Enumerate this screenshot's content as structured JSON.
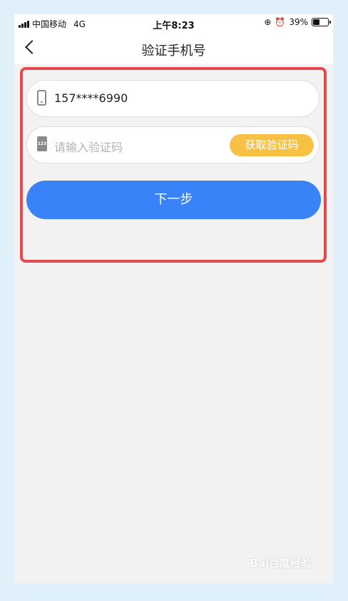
{
  "status_bar": {
    "carrier": "中国移动",
    "network": "4G",
    "time": "上午8:23",
    "battery": "39%",
    "battery_level": 0.39
  },
  "nav": {
    "title": "验证手机号",
    "back_icon": "chevron-left-icon"
  },
  "form": {
    "phone": {
      "icon": "mobile-phone-icon",
      "value": "157****6990"
    },
    "code": {
      "icon": "keypad-icon",
      "icon_text": "123",
      "placeholder": "请输入验证码",
      "get_code_label": "获取验证码"
    },
    "next_label": "下一步"
  },
  "watermark": "Bai百度经验",
  "colors": {
    "primary": "#3a82f7",
    "accent": "#f7c244",
    "highlight": "#e5484d",
    "background": "#f2f2f2",
    "frame": "#dff0fb"
  }
}
